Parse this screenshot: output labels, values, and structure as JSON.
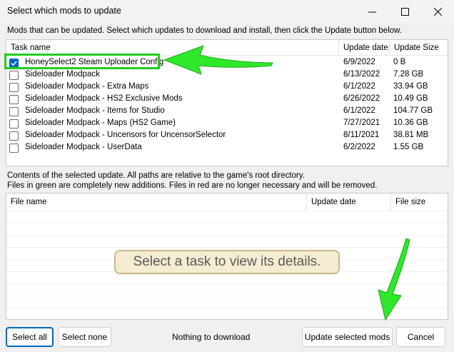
{
  "window": {
    "title": "Select which mods to update"
  },
  "intro": "Mods that can be updated. Select which updates to download and install, then click the Update button below.",
  "tasks": {
    "columns": [
      "Task name",
      "Update date",
      "Update Size"
    ],
    "rows": [
      {
        "name": "HoneySelect2 Steam Uploader Config",
        "date": "6/9/2022",
        "size": "0 B",
        "checked": true
      },
      {
        "name": "Sideloader Modpack",
        "date": "6/13/2022",
        "size": "7.28 GB",
        "checked": false
      },
      {
        "name": "Sideloader Modpack - Extra Maps",
        "date": "6/1/2022",
        "size": "33.94 GB",
        "checked": false
      },
      {
        "name": "Sideloader Modpack - HS2 Exclusive Mods",
        "date": "6/26/2022",
        "size": "10.49 GB",
        "checked": false
      },
      {
        "name": "Sideloader Modpack - Items for Studio",
        "date": "6/1/2022",
        "size": "104.77 GB",
        "checked": false
      },
      {
        "name": "Sideloader Modpack - Maps (HS2 Game)",
        "date": "7/27/2021",
        "size": "10.36 GB",
        "checked": false
      },
      {
        "name": "Sideloader Modpack - Uncensors for UncensorSelector",
        "date": "8/11/2021",
        "size": "38.81 MB",
        "checked": false
      },
      {
        "name": "Sideloader Modpack - UserData",
        "date": "6/2/2022",
        "size": "1.55 GB",
        "checked": false
      }
    ]
  },
  "details": {
    "line1": "Contents of the selected update. All paths are relative to the game's root directory.",
    "line2": "Files in green are completely new additions. Files in red are no longer necessary and will be removed.",
    "columns": [
      "File name",
      "Update date",
      "File size"
    ],
    "empty_message": "Select a task to view its details."
  },
  "footer": {
    "select_all": "Select all",
    "select_none": "Select none",
    "status": "Nothing to download",
    "update": "Update selected mods",
    "cancel": "Cancel"
  },
  "colors": {
    "accent": "#0067c0",
    "annotation_green": "#22cc1e"
  }
}
